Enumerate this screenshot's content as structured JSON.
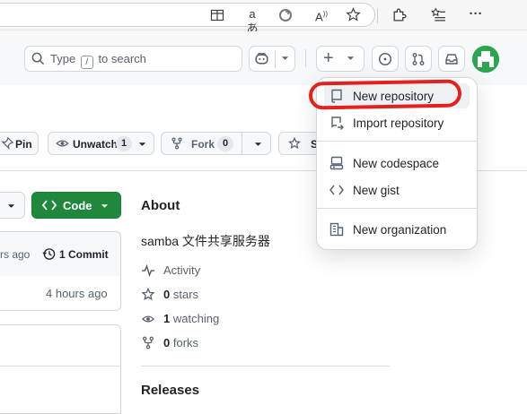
{
  "browser": {
    "icons": [
      "split-screen-icon",
      "read-aloud-icon",
      "refresh-icon",
      "text-size-icon",
      "favorite-icon",
      "extensions-icon",
      "favorites-bar-icon",
      "more-icon"
    ],
    "more_label": "···"
  },
  "header": {
    "search_prefix": "Type",
    "search_key": "/",
    "search_suffix": "to search",
    "add_label": "+"
  },
  "repo_actions": {
    "pin_label": "Pin",
    "watch_label": "Unwatch",
    "watch_count": "1",
    "fork_label": "Fork",
    "fork_count": "0",
    "star_partial": "S"
  },
  "files": {
    "code_label": "Code",
    "commit_time": "rs ago",
    "commit_count": "1 Commit",
    "row_time": "4 hours ago"
  },
  "about": {
    "title": "About",
    "description": "samba 文件共享服务器",
    "activity": "Activity",
    "stars_count": "0",
    "stars_label": "stars",
    "watching_count": "1",
    "watching_label": "watching",
    "forks_count": "0",
    "forks_label": "forks",
    "releases_title": "Releases"
  },
  "menu": {
    "items": [
      {
        "label": "New repository",
        "icon": "repo-icon"
      },
      {
        "label": "Import repository",
        "icon": "repo-push-icon"
      },
      {
        "label": "New codespace",
        "icon": "codespaces-icon"
      },
      {
        "label": "New gist",
        "icon": "code-icon"
      },
      {
        "label": "New organization",
        "icon": "organization-icon"
      }
    ]
  },
  "colors": {
    "accent_green": "#1f883d",
    "annotation_red": "#e3211d",
    "avatar_green": "#2da44e"
  }
}
